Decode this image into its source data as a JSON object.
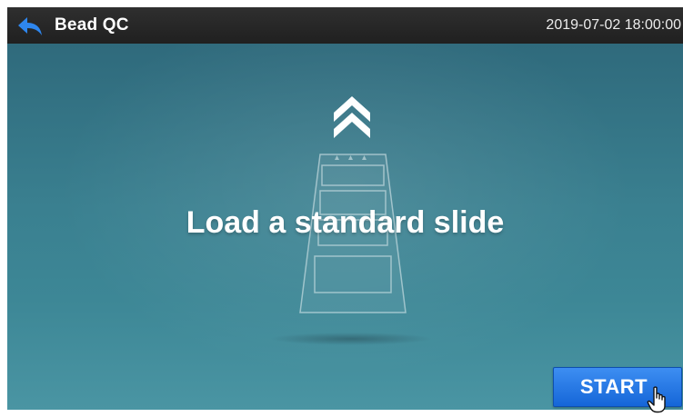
{
  "header": {
    "title": "Bead QC",
    "datetime": "2019-07-02 18:00:00",
    "back_icon": "back-arrow-icon"
  },
  "main": {
    "message": "Load a standard slide",
    "illustration_icons": [
      "chevron-double-up-icon",
      "slide-tray-icon"
    ]
  },
  "actions": {
    "start_label": "START"
  },
  "cursor": {
    "icon": "hand-pointer-icon"
  },
  "colors": {
    "titlebar": "#262626",
    "background": "#3a8090",
    "accent": "#1f74e0",
    "back_arrow": "#2e86ee"
  }
}
